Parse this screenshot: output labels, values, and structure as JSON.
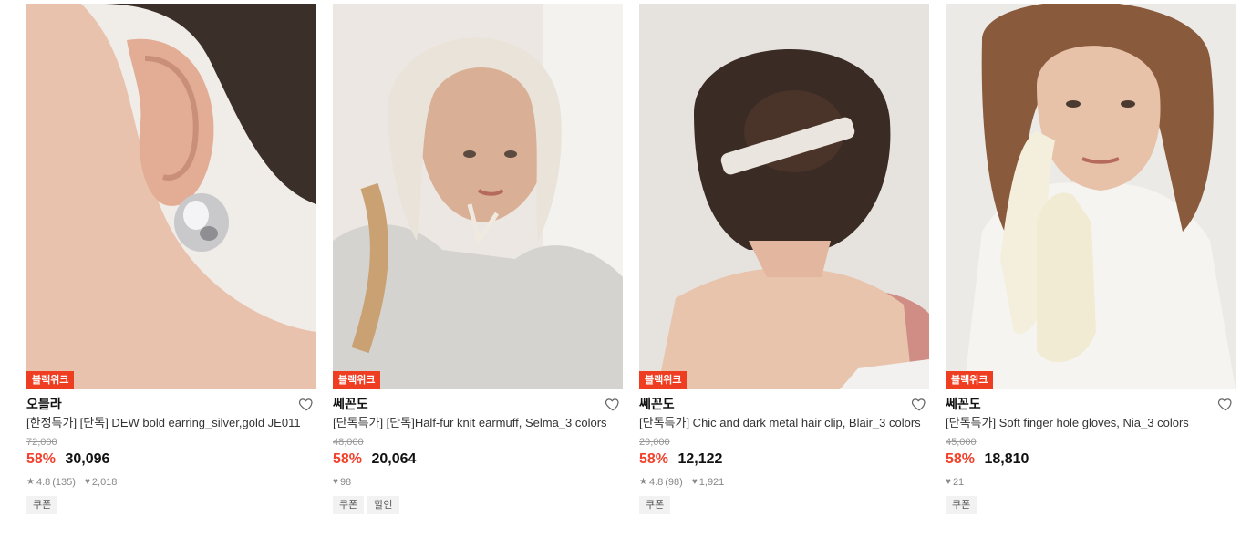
{
  "products": [
    {
      "badge": "블랙위크",
      "brand": "오블라",
      "name": "[한정특가] [단독] DEW bold earring_silver,gold JE011",
      "original_price": "72,000",
      "discount": "58%",
      "price": "30,096",
      "rating": "4.8",
      "reviews": "(135)",
      "likes": "2,018",
      "tags": [
        "쿠폰"
      ]
    },
    {
      "badge": "블랙위크",
      "brand": "쎄꼰도",
      "name": "[단독특가] [단독]Half-fur knit earmuff, Selma_3 colors",
      "original_price": "48,000",
      "discount": "58%",
      "price": "20,064",
      "rating": "",
      "reviews": "",
      "likes": "98",
      "tags": [
        "쿠폰",
        "할인"
      ]
    },
    {
      "badge": "블랙위크",
      "brand": "쎄꼰도",
      "name": "[단독특가] Chic and dark metal hair clip, Blair_3 colors",
      "original_price": "29,000",
      "discount": "58%",
      "price": "12,122",
      "rating": "4.8",
      "reviews": "(98)",
      "likes": "1,921",
      "tags": [
        "쿠폰"
      ]
    },
    {
      "badge": "블랙위크",
      "brand": "쎄꼰도",
      "name": "[단독특가] Soft finger hole gloves, Nia_3 colors",
      "original_price": "45,000",
      "discount": "58%",
      "price": "18,810",
      "rating": "",
      "reviews": "",
      "likes": "21",
      "tags": [
        "쿠폰"
      ]
    }
  ],
  "icons": {
    "like": "heart-outline-icon",
    "star": "star-icon",
    "heart_small": "heart-icon"
  },
  "colors": {
    "badge": "#ef3d22",
    "discount": "#f3402b"
  }
}
